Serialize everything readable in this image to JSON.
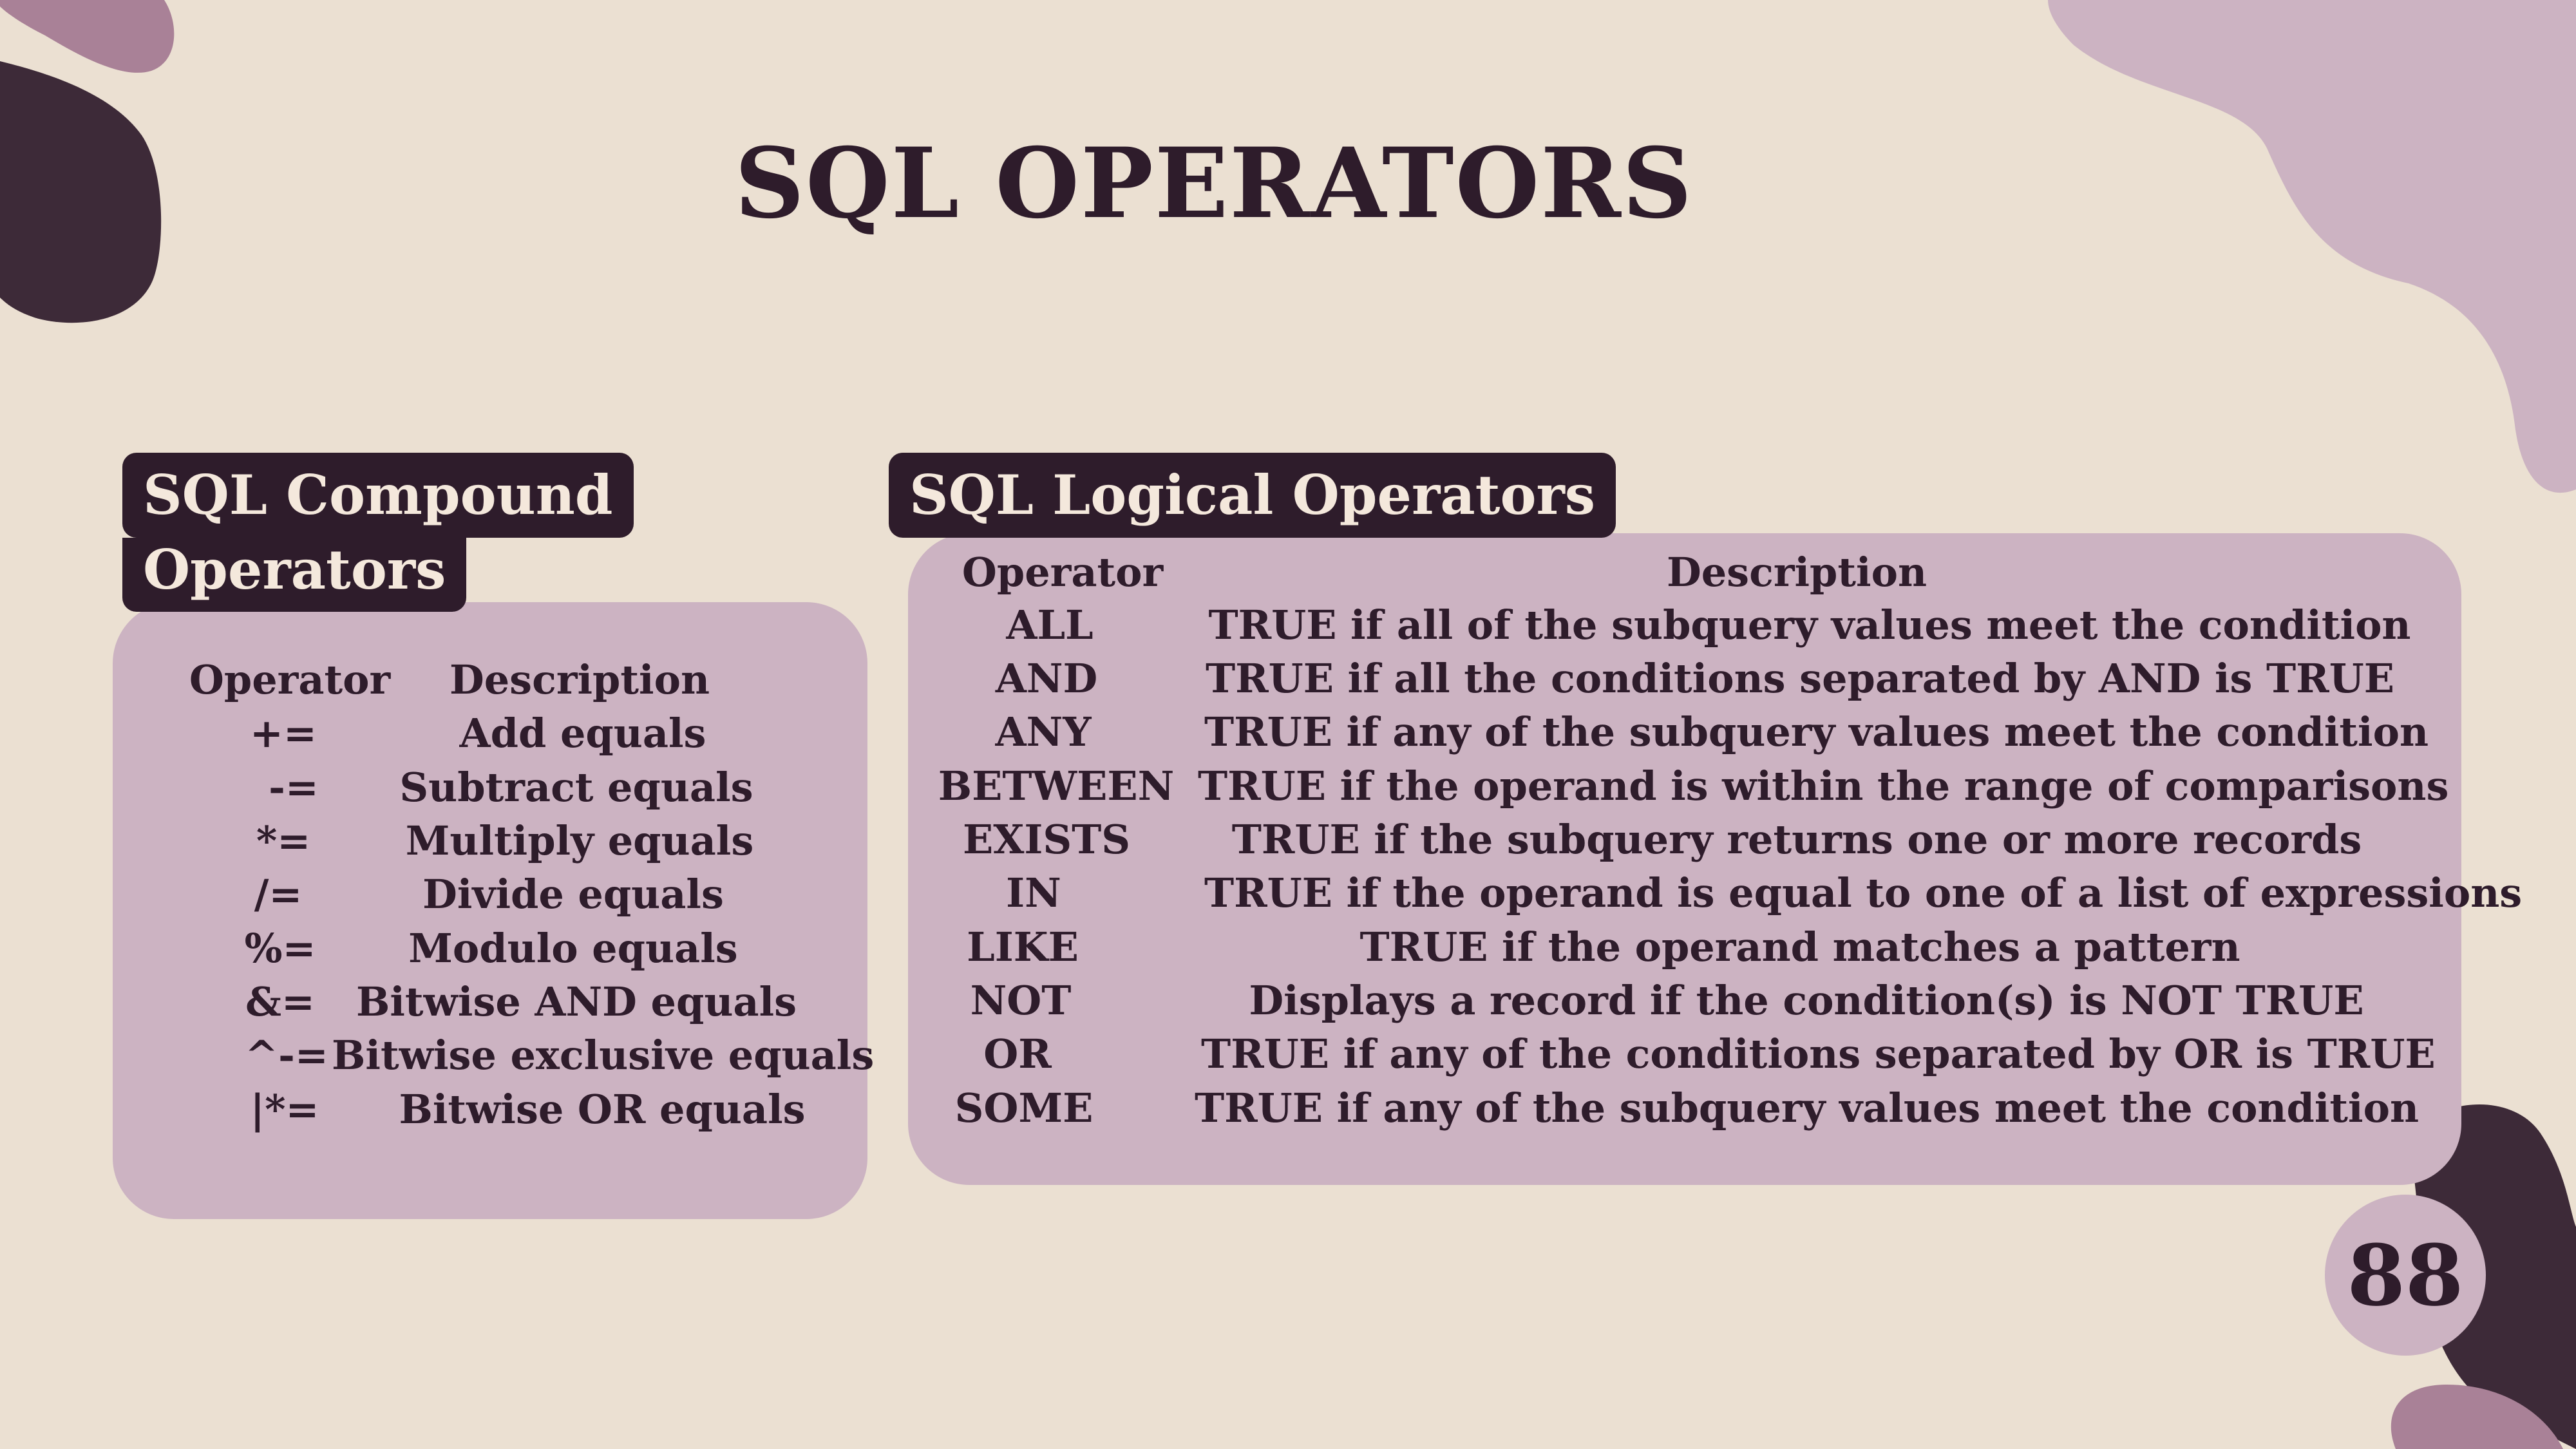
{
  "title": "SQL OPERATORS",
  "compound": {
    "heading_line1": "SQL Compound",
    "heading_line2": "Operators",
    "col_operator": "Operator",
    "col_description": "Description",
    "rows": [
      {
        "op": "+=",
        "desc": "Add equals"
      },
      {
        "op": "-=",
        "desc": "Subtract equals"
      },
      {
        "op": "*=",
        "desc": "Multiply equals"
      },
      {
        "op": "/=",
        "desc": "Divide equals"
      },
      {
        "op": "%=",
        "desc": "Modulo equals"
      },
      {
        "op": "&=",
        "desc": "Bitwise AND equals"
      },
      {
        "op": "^-=",
        "desc": "Bitwise exclusive equals"
      },
      {
        "op": "|*=",
        "desc": "Bitwise OR equals"
      }
    ]
  },
  "logical": {
    "heading": "SQL Logical Operators",
    "col_operator": "Operator",
    "col_description": "Description",
    "rows": [
      {
        "op": "ALL",
        "desc": "TRUE if all of the subquery values meet the condition"
      },
      {
        "op": "AND",
        "desc": "TRUE if all the conditions separated by AND is TRUE"
      },
      {
        "op": "ANY",
        "desc": "TRUE if any of the subquery values meet the condition"
      },
      {
        "op": "BETWEEN",
        "desc": "TRUE if the operand is within the range of comparisons"
      },
      {
        "op": "EXISTS",
        "desc": "TRUE if the subquery returns one or more records"
      },
      {
        "op": "IN",
        "desc": "TRUE if the operand is equal to one of a list of expressions"
      },
      {
        "op": "LIKE",
        "desc": "TRUE if the operand matches a pattern"
      },
      {
        "op": "NOT",
        "desc": "Displays a record if the condition(s) is NOT TRUE"
      },
      {
        "op": "OR",
        "desc": "TRUE if any of the conditions separated by OR is TRUE"
      },
      {
        "op": "SOME",
        "desc": "TRUE if any of the subquery values meet the condition"
      }
    ]
  },
  "page_number": "88",
  "colors": {
    "background": "#ebe0d2",
    "panel": "#ccb3c2",
    "dark": "#2e1c2b",
    "accent_mauve": "#a98197"
  }
}
